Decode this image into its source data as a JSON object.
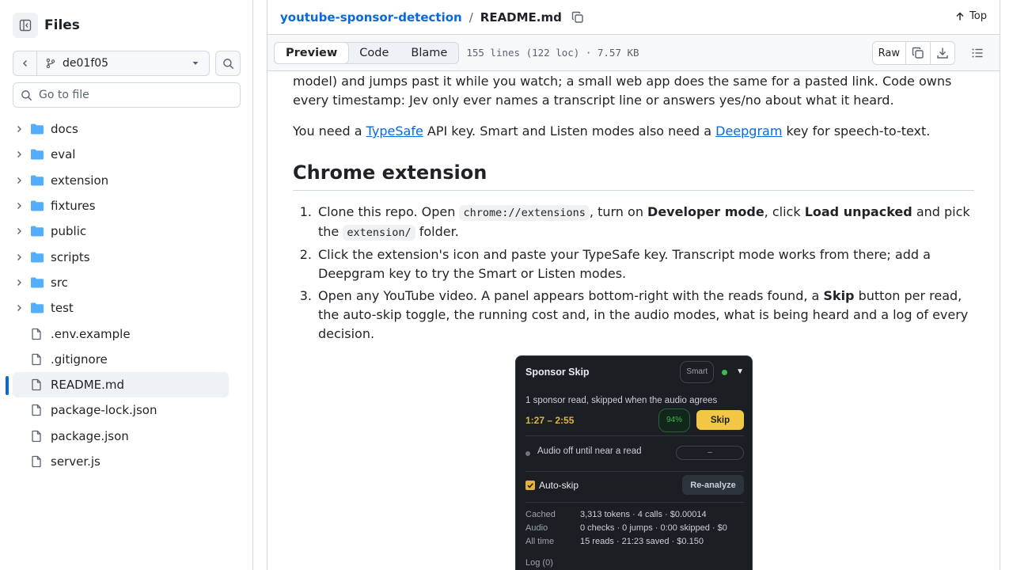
{
  "sidebar": {
    "title": "Files",
    "branch": "de01f05",
    "goto_placeholder": "Go to file",
    "items": [
      {
        "name": "docs",
        "type": "folder"
      },
      {
        "name": "eval",
        "type": "folder"
      },
      {
        "name": "extension",
        "type": "folder"
      },
      {
        "name": "fixtures",
        "type": "folder"
      },
      {
        "name": "public",
        "type": "folder"
      },
      {
        "name": "scripts",
        "type": "folder"
      },
      {
        "name": "src",
        "type": "folder"
      },
      {
        "name": "test",
        "type": "folder"
      },
      {
        "name": ".env.example",
        "type": "file"
      },
      {
        "name": ".gitignore",
        "type": "file"
      },
      {
        "name": "README.md",
        "type": "file",
        "selected": true
      },
      {
        "name": "package-lock.json",
        "type": "file"
      },
      {
        "name": "package.json",
        "type": "file"
      },
      {
        "name": "server.js",
        "type": "file"
      }
    ]
  },
  "header": {
    "repo": "youtube-sponsor-detection",
    "separator": "/",
    "file": "README.md",
    "top_label": "Top"
  },
  "toolbar": {
    "tabs": [
      "Preview",
      "Code",
      "Blame"
    ],
    "active_tab": "Preview",
    "meta": "155 lines (122 loc) · 7.57 KB",
    "raw_label": "Raw"
  },
  "content": {
    "para1": "model) and jumps past it while you watch; a small web app does the same for a pasted link. Code owns every timestamp: Jev only ever names a transcript line or answers yes/no about what it heard.",
    "para2_a": "You need a ",
    "para2_link1": "TypeSafe",
    "para2_b": " API key. Smart and Listen modes also need a ",
    "para2_link2": "Deepgram",
    "para2_c": " key for speech-to-text.",
    "heading": "Chrome extension",
    "step1_a": "Clone this repo. Open ",
    "step1_code1": "chrome://extensions",
    "step1_b": ", turn on ",
    "step1_bold1": "Developer mode",
    "step1_c": ", click ",
    "step1_bold2": "Load unpacked",
    "step1_d": " and pick the ",
    "step1_code2": "extension/",
    "step1_e": " folder.",
    "step2": "Click the extension's icon and paste your TypeSafe key. Transcript mode works from there; add a Deepgram key to try the Smart or Listen modes.",
    "step3_a": "Open any YouTube video. A panel appears bottom-right with the reads found, a ",
    "step3_bold": "Skip",
    "step3_b": " button per read, the auto-skip toggle, the running cost and, in the audio modes, what is being heard and a log of every decision."
  },
  "panel": {
    "title": "Sponsor Skip",
    "mode": "Smart",
    "status_color": "#3fb950",
    "summary": "1 sponsor read, skipped when the audio agrees",
    "read_range": "1:27 – 2:55",
    "confidence": "94%",
    "skip_label": "Skip",
    "audio_text": "Audio off until near a read",
    "audio_meter": "–",
    "autoskip_label": "Auto-skip",
    "reanalyze_label": "Re-analyze",
    "stats": [
      {
        "k": "Cached",
        "v": "3,313 tokens · 4 calls · $0.00014"
      },
      {
        "k": "Audio",
        "v": "0 checks · 0 jumps · 0:00 skipped · $0"
      },
      {
        "k": "All time",
        "v": "15 reads · 21:23 saved · $0.150"
      }
    ],
    "log_label": "Log (0)"
  },
  "colors": {
    "accent": "#0969da",
    "folder": "#54aeff",
    "panel_bg": "#1b1f24",
    "skip_btn": "#f2c744"
  }
}
